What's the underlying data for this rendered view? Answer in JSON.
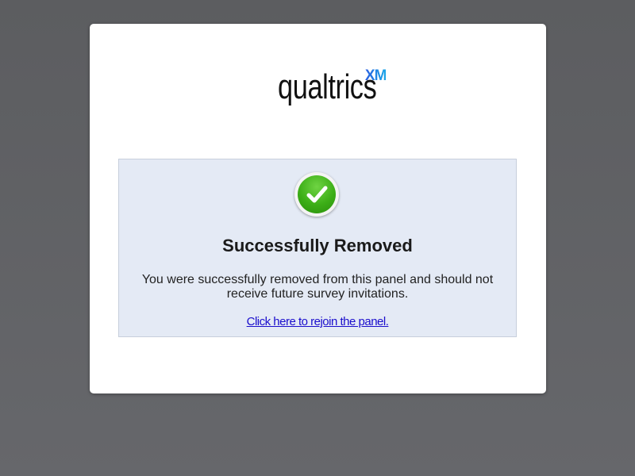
{
  "brand": {
    "wordmark": "qualtrics",
    "suffix": "XM"
  },
  "status": {
    "icon": "checkmark-icon",
    "title": "Successfully Removed",
    "message": "You were successfully removed from this panel and should not receive future survey invitations.",
    "rejoin_link": "Click here to rejoin the panel."
  },
  "colors": {
    "background": "#606164",
    "panel_background": "#e4eaf5",
    "success_green": "#3cae17",
    "link": "#1a0dcc",
    "xm_blue": "#1f6fdc"
  }
}
